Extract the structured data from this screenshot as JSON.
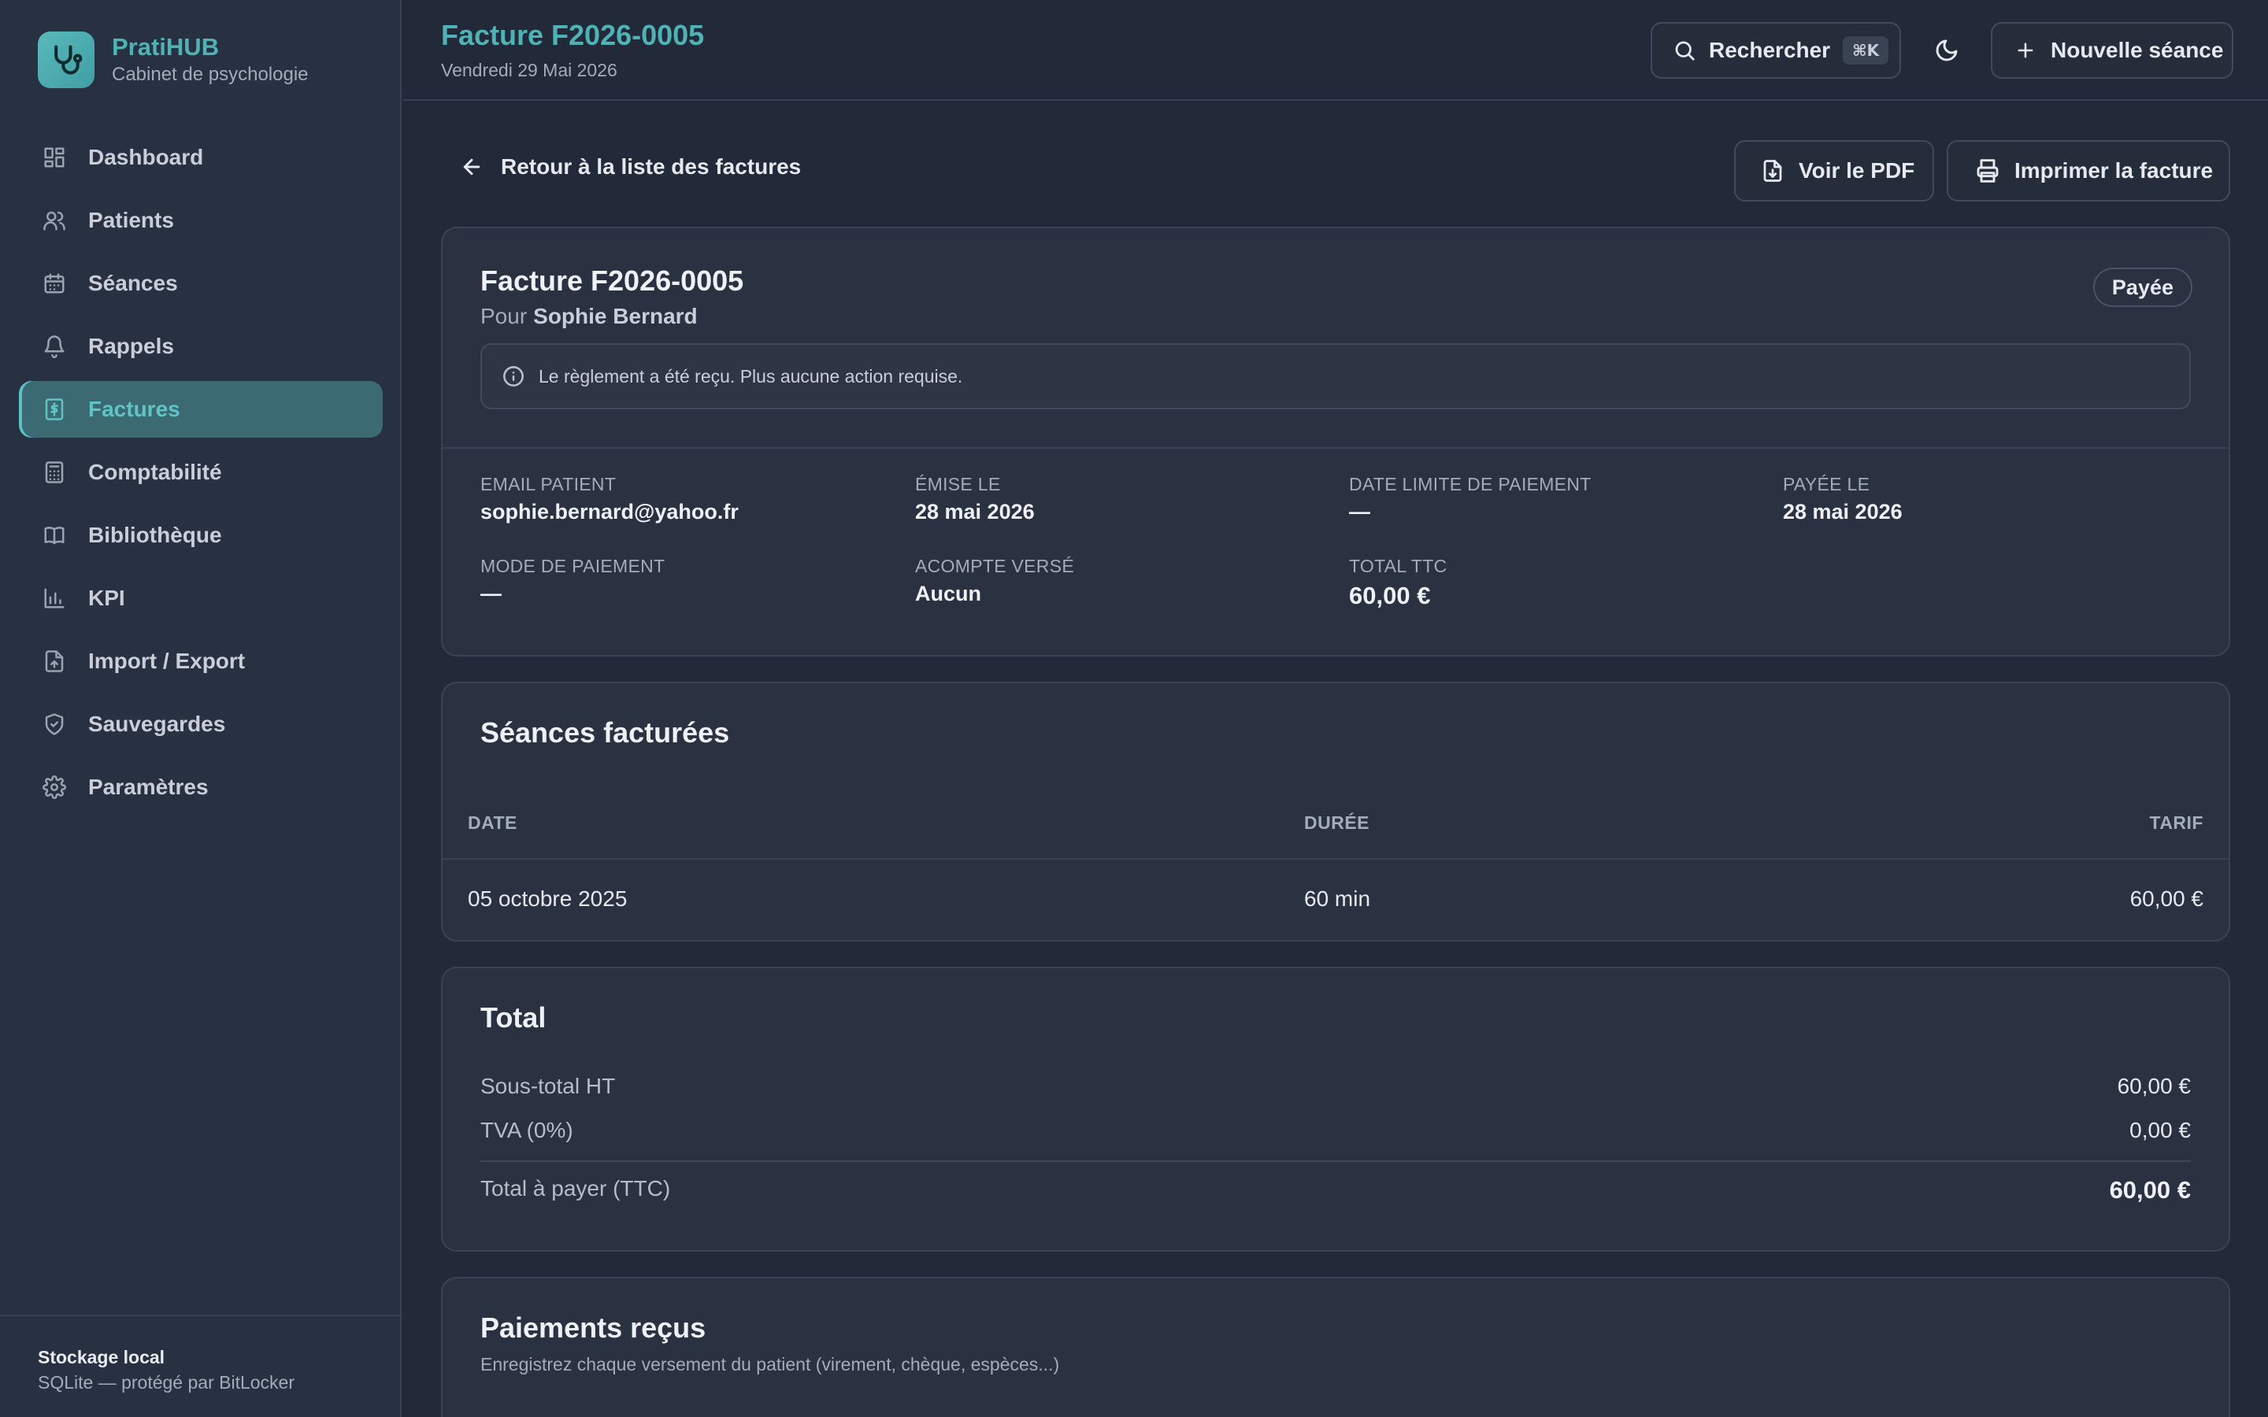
{
  "brand": {
    "name": "PratiHUB",
    "subtitle": "Cabinet de psychologie",
    "logo_icon": "stethoscope-icon",
    "accent": "#4fb3b6"
  },
  "sidebar": {
    "items": [
      {
        "label": "Dashboard",
        "icon": "dashboard-icon"
      },
      {
        "label": "Patients",
        "icon": "users-icon"
      },
      {
        "label": "Séances",
        "icon": "calendar-icon"
      },
      {
        "label": "Rappels",
        "icon": "bell-icon"
      },
      {
        "label": "Factures",
        "icon": "invoice-icon",
        "active": true
      },
      {
        "label": "Comptabilité",
        "icon": "calculator-icon"
      },
      {
        "label": "Bibliothèque",
        "icon": "book-icon"
      },
      {
        "label": "KPI",
        "icon": "bar-chart-icon"
      },
      {
        "label": "Import / Export",
        "icon": "file-import-icon"
      },
      {
        "label": "Sauvegardes",
        "icon": "shield-icon"
      },
      {
        "label": "Paramètres",
        "icon": "gear-icon"
      }
    ],
    "footer": {
      "title": "Stockage local",
      "subtitle": "SQLite — protégé par BitLocker"
    }
  },
  "header": {
    "title": "Facture F2026-0005",
    "date": "Vendredi 29 Mai 2026",
    "search_label": "Rechercher",
    "search_shortcut": "⌘K",
    "new_session_label": "Nouvelle séance"
  },
  "toolbar": {
    "back_label": "Retour à la liste des factures",
    "pdf_label": "Voir le PDF",
    "print_label": "Imprimer la facture"
  },
  "invoice": {
    "title": "Facture F2026-0005",
    "for_prefix": "Pour",
    "patient_name": "Sophie Bernard",
    "status": "Payée",
    "notice": "Le règlement a été reçu. Plus aucune action requise.",
    "fields": {
      "email": {
        "label": "Email patient",
        "value": "sophie.bernard@yahoo.fr"
      },
      "issued": {
        "label": "Émise le",
        "value": "28 mai 2026"
      },
      "due": {
        "label": "Date limite de paiement",
        "value": "—"
      },
      "paid": {
        "label": "Payée le",
        "value": "28 mai 2026"
      },
      "method": {
        "label": "Mode de paiement",
        "value": "—"
      },
      "deposit": {
        "label": "Acompte versé",
        "value": "Aucun"
      },
      "total": {
        "label": "Total TTC",
        "value": "60,00 €"
      }
    }
  },
  "sessions": {
    "title": "Séances facturées",
    "columns": [
      "DATE",
      "DURÉE",
      "TARIF"
    ],
    "rows": [
      {
        "date": "05 octobre 2025",
        "duration": "60 min",
        "rate": "60,00 €"
      }
    ]
  },
  "totals": {
    "title": "Total",
    "subtotal_label": "Sous-total HT",
    "subtotal_value": "60,00 €",
    "tax_label": "TVA (0%)",
    "tax_value": "0,00 €",
    "grand_label": "Total à payer (TTC)",
    "grand_value": "60,00 €"
  },
  "payments": {
    "title": "Paiements reçus",
    "subtitle": "Enregistrez chaque versement du patient (virement, chèque, espèces...)"
  }
}
